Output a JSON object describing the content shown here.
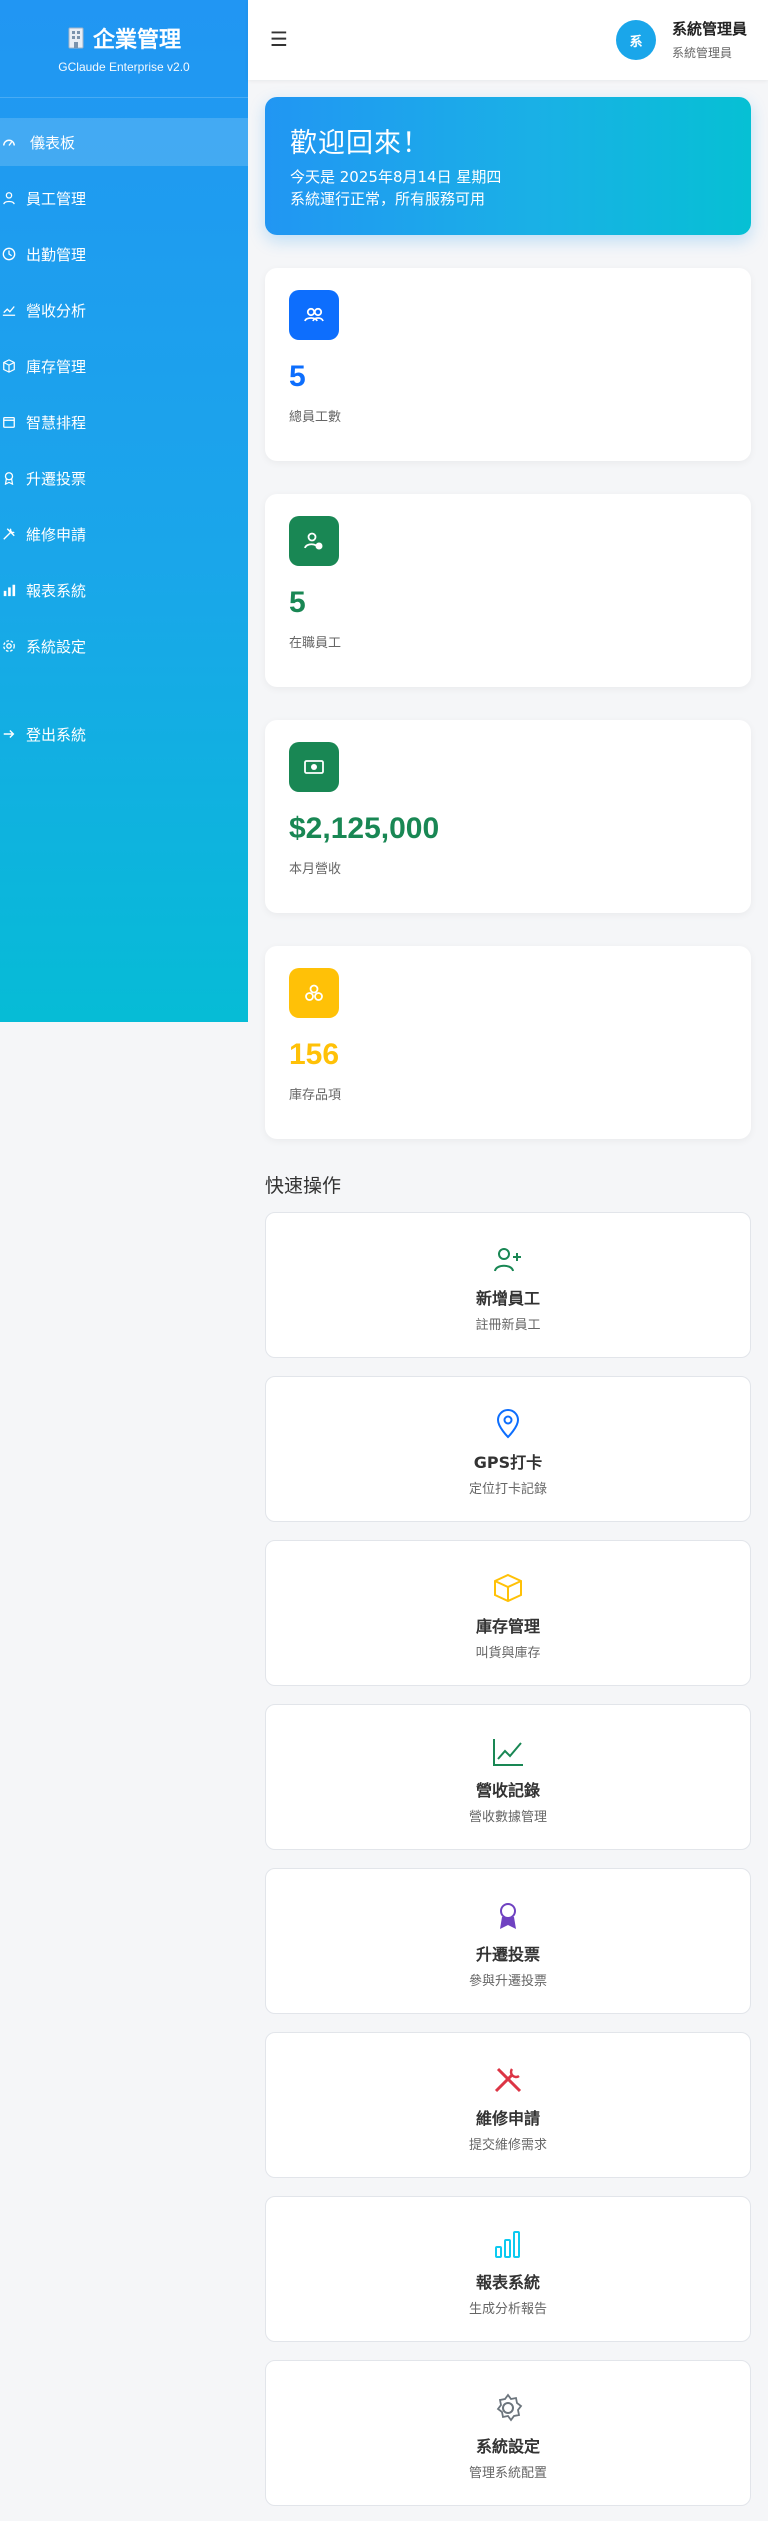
{
  "sidebar": {
    "title": "企業管理",
    "subtitle": "GClaude Enterprise v2.0",
    "items": [
      {
        "label": "儀表板",
        "icon": "dashboard-icon"
      },
      {
        "label": "員工管理",
        "icon": "users-icon"
      },
      {
        "label": "出勤管理",
        "icon": "clock-icon"
      },
      {
        "label": "營收分析",
        "icon": "chart-line-icon"
      },
      {
        "label": "庫存管理",
        "icon": "box-icon"
      },
      {
        "label": "智慧排程",
        "icon": "calendar-icon"
      },
      {
        "label": "升遷投票",
        "icon": "award-icon"
      },
      {
        "label": "維修申請",
        "icon": "tools-icon"
      },
      {
        "label": "報表系統",
        "icon": "bar-chart-icon"
      },
      {
        "label": "系統設定",
        "icon": "gear-icon"
      }
    ],
    "logout_label": "登出系統"
  },
  "header": {
    "menu_icon": "☰",
    "avatar_text": "系",
    "user_name": "系統管理員",
    "user_role": "系統管理員"
  },
  "welcome": {
    "title": "歡迎回來！",
    "date_line": "今天是 2025年8月14日 星期四",
    "status_line": "系統運行正常，所有服務可用"
  },
  "stats": [
    {
      "value": "5",
      "label": "總員工數",
      "color": "#0d6efd",
      "icon": "people-icon"
    },
    {
      "value": "5",
      "label": "在職員工",
      "color": "#198754",
      "icon": "person-check-icon"
    },
    {
      "value": "$2,125,000",
      "label": "本月營收",
      "color": "#198754",
      "icon": "cash-icon"
    },
    {
      "value": "156",
      "label": "庫存品項",
      "color": "#ffc107",
      "icon": "boxes-icon"
    }
  ],
  "quick_actions": {
    "title": "快速操作",
    "items": [
      {
        "title": "新增員工",
        "subtitle": "註冊新員工",
        "icon": "person-plus-icon",
        "color": "#198754"
      },
      {
        "title": "GPS打卡",
        "subtitle": "定位打卡記錄",
        "icon": "map-pin-icon",
        "color": "#0d6efd"
      },
      {
        "title": "庫存管理",
        "subtitle": "叫貨與庫存",
        "icon": "box-icon",
        "color": "#ffc107"
      },
      {
        "title": "營收記錄",
        "subtitle": "營收數據管理",
        "icon": "chart-line-icon",
        "color": "#198754"
      },
      {
        "title": "升遷投票",
        "subtitle": "參與升遷投票",
        "icon": "award-icon",
        "color": "#6f42c1"
      },
      {
        "title": "維修申請",
        "subtitle": "提交維修需求",
        "icon": "tools-icon",
        "color": "#dc3545"
      },
      {
        "title": "報表系統",
        "subtitle": "生成分析報告",
        "icon": "bar-chart-icon",
        "color": "#0dcaf0"
      },
      {
        "title": "系統設定",
        "subtitle": "管理系統配置",
        "icon": "gear-icon",
        "color": "#6c757d"
      }
    ]
  }
}
